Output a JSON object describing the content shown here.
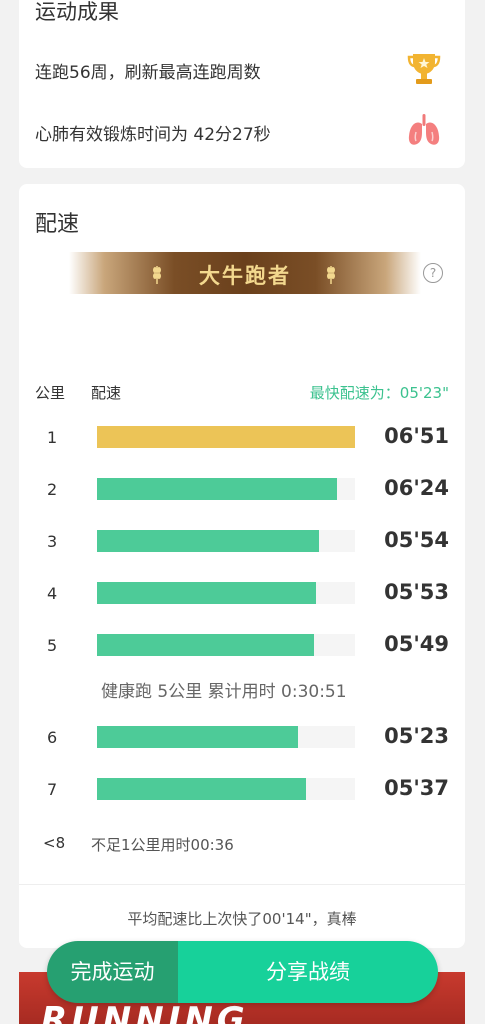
{
  "achievements": {
    "title": "运动成果",
    "items": [
      {
        "text": "连跑56周，刷新最高连跑周数",
        "icon": "trophy-icon"
      },
      {
        "text": "心肺有效锻炼时间为 42分27秒",
        "icon": "lungs-icon"
      }
    ]
  },
  "pace": {
    "title": "配速",
    "badge": "大牛跑者",
    "col_km": "公里",
    "col_pace": "配速",
    "fastest_label": "最快配速为：05'23\"",
    "rows": [
      {
        "km": "1",
        "pace": "06'51",
        "fill": 1.0,
        "slowest": true
      },
      {
        "km": "2",
        "pace": "06'24",
        "fill": 0.93
      },
      {
        "km": "3",
        "pace": "05'54",
        "fill": 0.86
      },
      {
        "km": "4",
        "pace": "05'53",
        "fill": 0.85
      },
      {
        "km": "5",
        "pace": "05'49",
        "fill": 0.84
      },
      {
        "km": "6",
        "pace": "05'23",
        "fill": 0.78
      },
      {
        "km": "7",
        "pace": "05'37",
        "fill": 0.81
      }
    ],
    "milestone": "健康跑 5公里 累计用时 0:30:51",
    "partial_num": "<8",
    "partial_text": "不足1公里用时00:36",
    "compare": "平均配速比上次快了00'14\"，真棒"
  },
  "photo_word": "RUNNING",
  "actions": {
    "finish": "完成运动",
    "share": "分享战绩"
  },
  "colors": {
    "bar": "#4dcb98",
    "slowest_bar": "#ecc457",
    "accent": "#3cc28f",
    "finish_btn": "#26a071",
    "share_btn": "#17d19a"
  }
}
